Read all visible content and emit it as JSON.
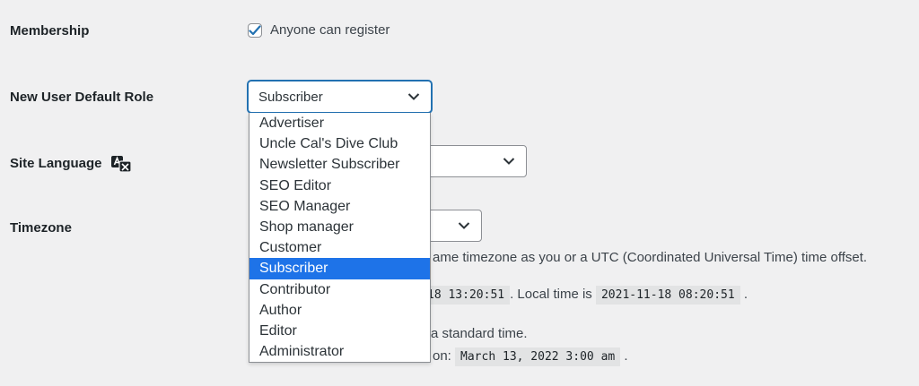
{
  "rows": {
    "membership": {
      "label": "Membership",
      "checkbox_label": "Anyone can register",
      "checked": true
    },
    "default_role": {
      "label": "New User Default Role",
      "selected": "Subscriber"
    },
    "site_language": {
      "label": "Site Language",
      "icon": "translation-icon"
    },
    "timezone": {
      "label": "Timezone"
    }
  },
  "role_options": [
    "Advertiser",
    "Uncle Cal's Dive Club",
    "Newsletter Subscriber",
    "SEO Editor",
    "SEO Manager",
    "Shop manager",
    "Customer",
    "Subscriber",
    "Contributor",
    "Author",
    "Editor",
    "Administrator"
  ],
  "timezone_info": {
    "desc_partial": "ame timezone as you or a UTC (Coordinated Universal Time) time offset.",
    "universal_time_partial": "18 13:20:51",
    "local_time_text": ". Local time is",
    "local_time": "2021-11-18 08:20:51",
    "local_time_end": ".",
    "standard_time_partial": "a standard time.",
    "dst_partial": "on:",
    "dst_time": "March 13, 2022 3:00 am",
    "dst_end": "."
  },
  "colors": {
    "accent": "#2271b1",
    "selected_option": "#1e73e8",
    "background": "#f0f0f1"
  }
}
